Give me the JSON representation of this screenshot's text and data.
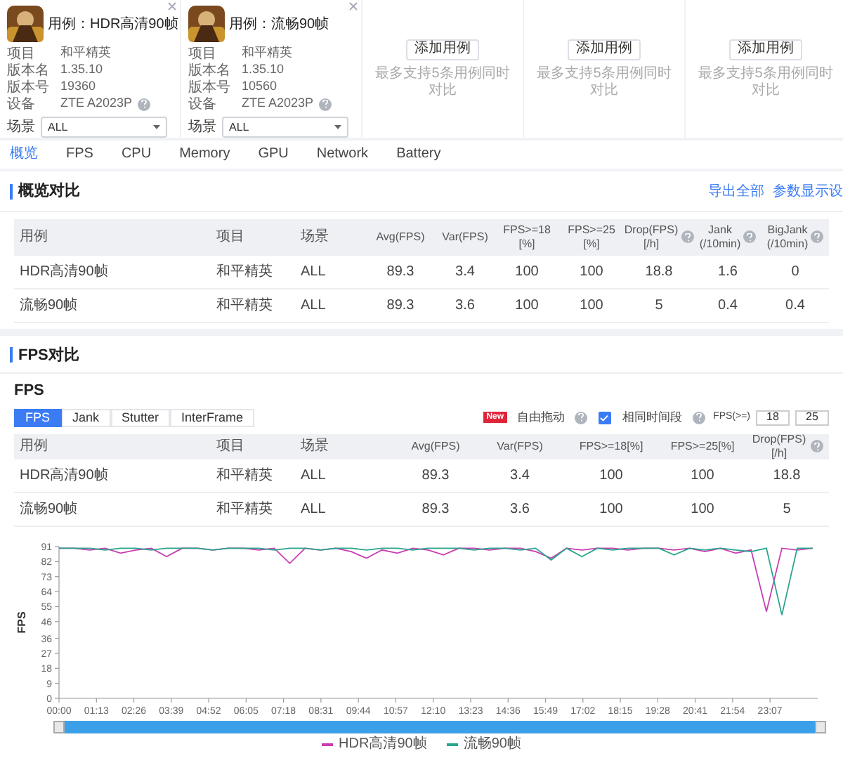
{
  "cases": [
    {
      "kind": "case",
      "title": "用例：HDR高清90帧",
      "info": [
        {
          "label": "项目",
          "value": "和平精英"
        },
        {
          "label": "版本名",
          "value": "1.35.10"
        },
        {
          "label": "版本号",
          "value": "19360"
        },
        {
          "label": "设备",
          "value": "ZTE A2023P"
        }
      ],
      "scene_label": "场景",
      "scene": "ALL"
    },
    {
      "kind": "case",
      "title": "用例：流畅90帧",
      "info": [
        {
          "label": "项目",
          "value": "和平精英"
        },
        {
          "label": "版本名",
          "value": "1.35.10"
        },
        {
          "label": "版本号",
          "value": "10560"
        },
        {
          "label": "设备",
          "value": "ZTE A2023P"
        }
      ],
      "scene_label": "场景",
      "scene": "ALL"
    },
    {
      "kind": "empty",
      "button": "添加用例",
      "hint": "最多支持5条用例同时对比"
    },
    {
      "kind": "empty",
      "button": "添加用例",
      "hint": "最多支持5条用例同时对比"
    },
    {
      "kind": "empty",
      "button": "添加用例",
      "hint": "最多支持5条用例同时对比"
    }
  ],
  "tabs": [
    {
      "label": "概览",
      "selected": true
    },
    {
      "label": "FPS",
      "selected": false
    },
    {
      "label": "CPU",
      "selected": false
    },
    {
      "label": "Memory",
      "selected": false
    },
    {
      "label": "GPU",
      "selected": false
    },
    {
      "label": "Network",
      "selected": false
    },
    {
      "label": "Battery",
      "selected": false
    }
  ],
  "overview": {
    "title": "概览对比",
    "links": [
      "导出全部",
      "参数显示设"
    ],
    "columns": [
      {
        "label": "用例"
      },
      {
        "label": "项目"
      },
      {
        "label": "场景"
      },
      {
        "label": "Avg(FPS)"
      },
      {
        "label": "Var(FPS)"
      },
      {
        "label": "FPS>=18 [%]"
      },
      {
        "label": "FPS>=25 [%]"
      },
      {
        "label": "Drop(FPS) [/h]",
        "help": true
      },
      {
        "label": "Jank (/10min)",
        "help": true
      },
      {
        "label": "BigJank (/10min)",
        "help": true
      }
    ],
    "rows": [
      [
        "HDR高清90帧",
        "和平精英",
        "ALL",
        "89.3",
        "3.4",
        "100",
        "100",
        "18.8",
        "1.6",
        "0"
      ],
      [
        "流畅90帧",
        "和平精英",
        "ALL",
        "89.3",
        "3.6",
        "100",
        "100",
        "5",
        "0.4",
        "0.4"
      ]
    ]
  },
  "fps": {
    "title": "FPS对比",
    "subtitle": "FPS",
    "subtabs": [
      {
        "label": "FPS",
        "selected": true
      },
      {
        "label": "Jank",
        "selected": false
      },
      {
        "label": "Stutter",
        "selected": false
      },
      {
        "label": "InterFrame",
        "selected": false
      }
    ],
    "badge": "New",
    "drag_label": "自由拖动",
    "sync": {
      "label": "相同时间段",
      "checked": true
    },
    "threshold_label": "FPS(>=)",
    "thresholds": [
      "18",
      "25"
    ],
    "columns": [
      {
        "label": "用例"
      },
      {
        "label": "项目"
      },
      {
        "label": "场景"
      },
      {
        "label": "Avg(FPS)"
      },
      {
        "label": "Var(FPS)"
      },
      {
        "label": "FPS>=18[%]"
      },
      {
        "label": "FPS>=25[%]"
      },
      {
        "label": "Drop(FPS)[/h]",
        "help": true
      }
    ],
    "rows": [
      [
        "HDR高清90帧",
        "和平精英",
        "ALL",
        "89.3",
        "3.4",
        "100",
        "100",
        "18.8"
      ],
      [
        "流畅90帧",
        "和平精英",
        "ALL",
        "89.3",
        "3.6",
        "100",
        "100",
        "5"
      ]
    ],
    "chart_data": {
      "type": "line",
      "ylabel": "FPS",
      "x": [
        0,
        30,
        60,
        90,
        120,
        150,
        180,
        210,
        240,
        270,
        300,
        330,
        360,
        390,
        420,
        450,
        480,
        510,
        540,
        570,
        600,
        630,
        660,
        690,
        720,
        750,
        780,
        810,
        840,
        870,
        900,
        930,
        960,
        990,
        1020,
        1050,
        1080,
        1110,
        1140,
        1170,
        1200,
        1230,
        1260,
        1290,
        1320,
        1350,
        1380,
        1410,
        1440,
        1470
      ],
      "xlim": [
        0,
        1480
      ],
      "ylim": [
        0,
        91
      ],
      "yticks": [
        {
          "value": 0,
          "label": "0"
        },
        {
          "value": 9,
          "label": "9"
        },
        {
          "value": 18,
          "label": "18"
        },
        {
          "value": 27,
          "label": "27"
        },
        {
          "value": 36,
          "label": "36"
        },
        {
          "value": 46,
          "label": "46"
        },
        {
          "value": 55,
          "label": "55"
        },
        {
          "value": 64,
          "label": "64"
        },
        {
          "value": 73,
          "label": "73"
        },
        {
          "value": 82,
          "label": "82"
        },
        {
          "value": 91,
          "label": "91"
        }
      ],
      "legend": true,
      "xticks": [
        {
          "value": 0,
          "label": "00:00"
        },
        {
          "value": 73,
          "label": "01:13"
        },
        {
          "value": 146,
          "label": "02:26"
        },
        {
          "value": 219,
          "label": "03:39"
        },
        {
          "value": 292,
          "label": "04:52"
        },
        {
          "value": 365,
          "label": "06:05"
        },
        {
          "value": 438,
          "label": "07:18"
        },
        {
          "value": 511,
          "label": "08:31"
        },
        {
          "value": 584,
          "label": "09:44"
        },
        {
          "value": 657,
          "label": "10:57"
        },
        {
          "value": 730,
          "label": "12:10"
        },
        {
          "value": 803,
          "label": "13:23"
        },
        {
          "value": 876,
          "label": "14:36"
        },
        {
          "value": 949,
          "label": "15:49"
        },
        {
          "value": 1022,
          "label": "17:02"
        },
        {
          "value": 1095,
          "label": "18:15"
        },
        {
          "value": 1168,
          "label": "19:28"
        },
        {
          "value": 1241,
          "label": "20:41"
        },
        {
          "value": 1314,
          "label": "21:54"
        },
        {
          "value": 1387,
          "label": "23:07"
        }
      ],
      "series": [
        {
          "name": "HDR高清90帧",
          "color": "#c83cb4",
          "values": [
            90,
            90,
            89,
            90,
            87,
            89,
            90,
            85,
            90,
            90,
            89,
            90,
            90,
            89,
            90,
            81,
            90,
            89,
            90,
            88,
            84,
            89,
            87,
            90,
            89,
            86,
            90,
            90,
            89,
            90,
            90,
            88,
            84,
            90,
            89,
            90,
            90,
            89,
            90,
            90,
            89,
            90,
            88,
            90,
            87,
            89,
            52,
            90,
            89,
            90
          ]
        },
        {
          "name": "流畅90帧",
          "color": "#2aa58c",
          "values": [
            90,
            90,
            90,
            89,
            90,
            90,
            89,
            90,
            90,
            90,
            89,
            90,
            90,
            90,
            89,
            90,
            90,
            89,
            90,
            90,
            89,
            90,
            90,
            89,
            90,
            90,
            90,
            89,
            90,
            90,
            89,
            90,
            83,
            90,
            85,
            90,
            89,
            90,
            90,
            90,
            86,
            90,
            89,
            90,
            89,
            88,
            90,
            50,
            90,
            90
          ]
        }
      ]
    }
  }
}
